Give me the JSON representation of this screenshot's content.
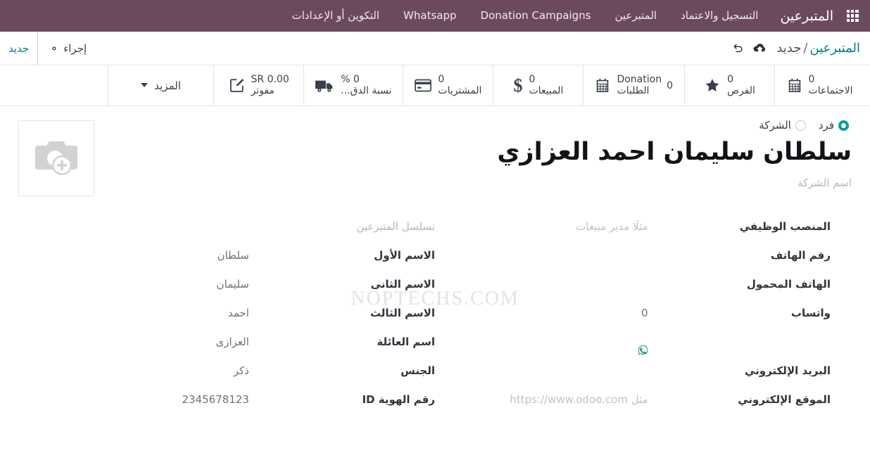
{
  "navbar": {
    "apps_icon": "apps-grid-icon",
    "brand": "المتبرعين",
    "items": [
      {
        "label": "التسجيل والاعتماد",
        "name": "nav-item-registration"
      },
      {
        "label": "المتبرعين",
        "name": "nav-item-donors"
      },
      {
        "label": "Donation Campaigns",
        "name": "nav-item-donation-campaigns"
      },
      {
        "label": "Whatsapp",
        "name": "nav-item-whatsapp"
      },
      {
        "label": "التكوين أو الإعدادات",
        "name": "nav-item-configuration"
      }
    ],
    "bg_color": "#6b4a60"
  },
  "controlpanel": {
    "breadcrumb_root": "المتبرعين",
    "breadcrumb_sep": "/",
    "breadcrumb_current": "جديد",
    "save_icon": "cloud-upload-icon",
    "discard_icon": "undo-icon",
    "gear_icon": "gear-icon",
    "action_label": "إجراء",
    "new_label": "جديد",
    "accent_color": "#017e84"
  },
  "stats": {
    "more_label": "المزيد",
    "more_icon": "chevron-down-icon",
    "buttons": [
      {
        "value": "0.00 SR",
        "label": "مفوتر",
        "icon": "pencil-square-icon",
        "name": "stat-invoiced",
        "layout": "stacked"
      },
      {
        "value": "0 %",
        "label": "نسبة الدق...",
        "icon": "truck-icon",
        "name": "stat-ontime-rate",
        "layout": "stacked"
      },
      {
        "value": "0",
        "label": "المشتريات",
        "icon": "credit-card-icon",
        "name": "stat-purchases",
        "layout": "stacked"
      },
      {
        "value": "0",
        "label": "المبيعات",
        "icon": "dollar-icon",
        "name": "stat-sales",
        "layout": "stacked"
      },
      {
        "value": "0",
        "label": "Donation الطلبات",
        "label_line1": "Donation",
        "label_line2": "الطلبات",
        "icon": "calendar-icon",
        "name": "stat-donation-orders",
        "layout": "inline"
      },
      {
        "value": "0",
        "label": "الفرص",
        "icon": "star-icon",
        "name": "stat-opportunities",
        "layout": "stacked"
      },
      {
        "value": "0",
        "label": "الاجتماعات",
        "icon": "calendar-icon",
        "name": "stat-meetings",
        "layout": "stacked"
      }
    ]
  },
  "form": {
    "watermark": "NOPTECHS.COM",
    "partner_type": {
      "selected": "فرد",
      "options": [
        {
          "label": "فرد",
          "selected": true,
          "name": "radio-individual"
        },
        {
          "label": "الشركة",
          "selected": false,
          "name": "radio-company"
        }
      ]
    },
    "title": "سلطان سليمان احمد العزازي",
    "subtitle_placeholder": "اسم الشركة",
    "avatar_icon": "camera-add-icon",
    "right_column": [
      {
        "label": "تسلسل المتبرعين",
        "value": "",
        "muted_label": true,
        "name": "field-donor-sequence"
      },
      {
        "label": "الاسم الأول",
        "value": "سلطان",
        "name": "field-first-name"
      },
      {
        "label": "الاسم الثانى",
        "value": "سليمان",
        "name": "field-second-name"
      },
      {
        "label": "الاسم الثالث",
        "value": "احمد",
        "name": "field-third-name"
      },
      {
        "label": "اسم العائلة",
        "value": "العزازى",
        "name": "field-family-name"
      },
      {
        "label": "الجنس",
        "value": "ذكر",
        "name": "field-gender"
      },
      {
        "label": "رقم الهوية ID",
        "value": "2345678123",
        "ltr": true,
        "name": "field-id-number"
      }
    ],
    "left_column": [
      {
        "label": "المنصب الوظيفي",
        "value": "مثلًا مدير مبيعات",
        "placeholder": true,
        "name": "field-job-position"
      },
      {
        "label": "رقم الهاتف",
        "value": "",
        "name": "field-phone"
      },
      {
        "label": "الهاتف المحمول",
        "value": "",
        "name": "field-mobile"
      },
      {
        "label": "واتساب",
        "value": "0",
        "ltr": true,
        "name": "field-whatsapp"
      },
      {
        "label": "",
        "value": "",
        "whatsapp_icon": true,
        "name": "field-whatsapp-link"
      },
      {
        "label": "البريد الإلكتروني",
        "value": "",
        "name": "field-email"
      },
      {
        "label": "الموقع الإلكتروني",
        "value": "مثل https://www.odoo.com",
        "placeholder": true,
        "name": "field-website"
      }
    ]
  }
}
